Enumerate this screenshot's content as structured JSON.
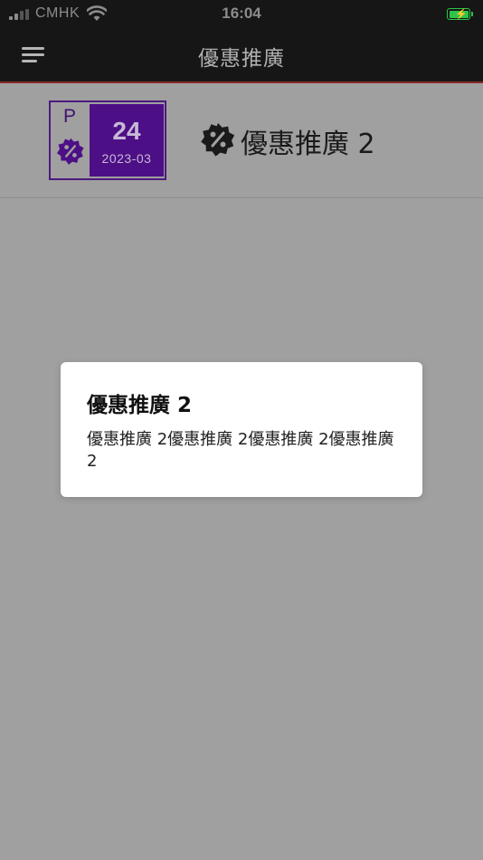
{
  "status_bar": {
    "carrier": "CMHK",
    "time": "16:04",
    "battery_color": "#2ec44a"
  },
  "nav": {
    "title": "優惠推廣",
    "menu_icon": "hamburger-menu-icon"
  },
  "promo": {
    "badge_letter": "P",
    "badge_icon": "discount-percent-badge-icon",
    "day": "24",
    "month": "2023-03",
    "title_icon": "discount-percent-badge-icon",
    "title": "優惠推廣 2",
    "accent_color": "#4d0f86"
  },
  "dialog": {
    "title": "優惠推廣 2",
    "message": "優惠推廣 2優惠推廣 2優惠推廣 2優惠推廣 2"
  }
}
